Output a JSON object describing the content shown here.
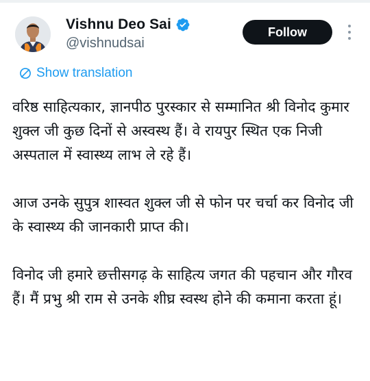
{
  "author": {
    "name": "Vishnu Deo Sai",
    "handle": "@vishnudsai",
    "verified": true,
    "avatar_icon": "user-avatar"
  },
  "actions": {
    "follow_label": "Follow",
    "more_icon": "more-vertical-icon"
  },
  "translation": {
    "label": "Show translation",
    "icon": "globe-icon"
  },
  "tweet": {
    "paragraphs": [
      "वरिष्ठ साहित्यकार, ज्ञानपीठ पुरस्कार से सम्मानित श्री विनोद कुमार शुक्ल जी कुछ दिनों से अस्वस्थ हैं। वे रायपुर स्थित एक निजी अस्पताल में स्वास्थ्य लाभ ले रहे हैं।",
      "आज उनके सुपुत्र शास्वत शुक्ल जी से फोन पर चर्चा कर विनोद जी के स्वास्थ्य की जानकारी प्राप्त की।",
      "विनोद जी हमारे छत्तीसगढ़ के साहित्य जगत की पहचान और गौरव हैं। मैं प्रभु श्री राम से उनके शीघ्र स्वस्थ होने की कमाना करता हूं।"
    ]
  },
  "colors": {
    "link": "#1d9bf0",
    "verified": "#1d9bf0",
    "button_bg": "#0f1419",
    "secondary_text": "#536471"
  }
}
